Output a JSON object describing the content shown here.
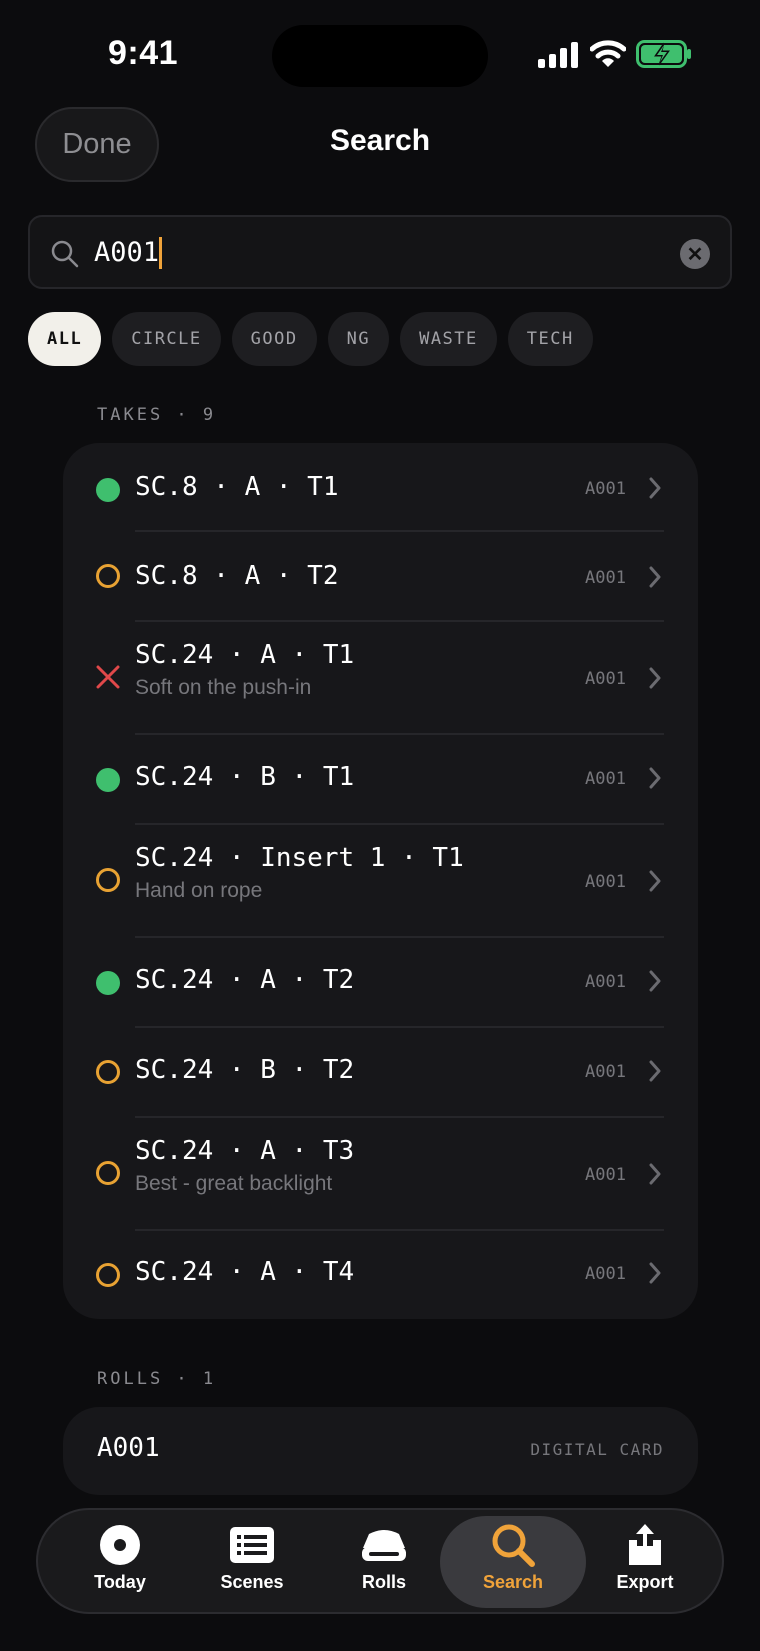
{
  "status_bar": {
    "time": "9:41"
  },
  "nav": {
    "done_label": "Done",
    "title": "Search"
  },
  "search": {
    "value": "A001"
  },
  "filters": [
    {
      "label": "ALL",
      "active": true
    },
    {
      "label": "CIRCLE",
      "active": false
    },
    {
      "label": "GOOD",
      "active": false
    },
    {
      "label": "NG",
      "active": false
    },
    {
      "label": "WASTE",
      "active": false
    },
    {
      "label": "TECH",
      "active": false
    }
  ],
  "takes": {
    "header": "TAKES · 9",
    "items": [
      {
        "title": "SC.8 · A · T1",
        "note": "",
        "roll": "A001",
        "status": "good"
      },
      {
        "title": "SC.8 · A · T2",
        "note": "",
        "roll": "A001",
        "status": "pending"
      },
      {
        "title": "SC.24 · A · T1",
        "note": "Soft on the push-in",
        "roll": "A001",
        "status": "ng"
      },
      {
        "title": "SC.24 · B · T1",
        "note": "",
        "roll": "A001",
        "status": "good"
      },
      {
        "title": "SC.24 · Insert 1 · T1",
        "note": "Hand on rope",
        "roll": "A001",
        "status": "pending"
      },
      {
        "title": "SC.24 · A · T2",
        "note": "",
        "roll": "A001",
        "status": "good"
      },
      {
        "title": "SC.24 · B · T2",
        "note": "",
        "roll": "A001",
        "status": "pending"
      },
      {
        "title": "SC.24 · A · T3",
        "note": "Best - great backlight",
        "roll": "A001",
        "status": "pending"
      },
      {
        "title": "SC.24 · A · T4",
        "note": "",
        "roll": "A001",
        "status": "pending"
      }
    ]
  },
  "rolls": {
    "header": "ROLLS · 1",
    "items": [
      {
        "name": "A001",
        "type": "DIGITAL CARD"
      }
    ]
  },
  "tab_bar": {
    "tabs": [
      {
        "label": "Today",
        "icon": "record-icon",
        "active": false
      },
      {
        "label": "Scenes",
        "icon": "list-icon",
        "active": false
      },
      {
        "label": "Rolls",
        "icon": "film-roll-icon",
        "active": false
      },
      {
        "label": "Search",
        "icon": "search-icon",
        "active": true
      },
      {
        "label": "Export",
        "icon": "share-icon",
        "active": false
      }
    ]
  },
  "colors": {
    "background": "#0c0c0e",
    "accent": "#f0a33a",
    "good": "#3fbf6e",
    "ng": "#e0484a",
    "card": "#17171a"
  }
}
